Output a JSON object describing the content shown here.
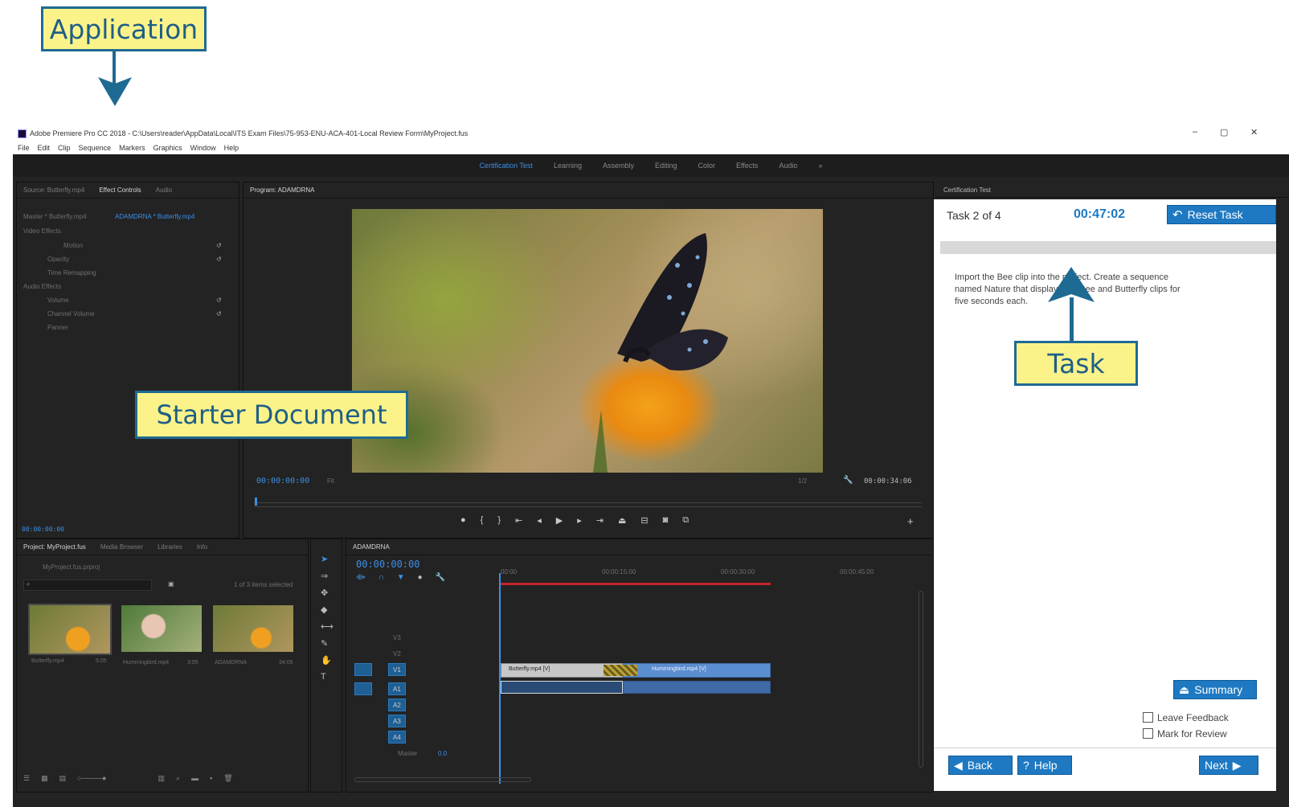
{
  "callouts": {
    "application": "Application",
    "starter_document": "Starter Document",
    "task": "Task"
  },
  "window": {
    "title": "Adobe Premiere Pro CC 2018 - C:\\Users\\reader\\AppData\\Local\\ITS Exam Files\\75-953-ENU-ACA-401-Local Review Form\\MyProject.fus",
    "menu": [
      "File",
      "Edit",
      "Clip",
      "Sequence",
      "Markers",
      "Graphics",
      "Window",
      "Help"
    ],
    "workspaces": [
      "Certification Test",
      "Learning",
      "Assembly",
      "Editing",
      "Color",
      "Effects",
      "Audio"
    ],
    "controls": [
      "–",
      "▢",
      "✕"
    ]
  },
  "effect_controls": {
    "tabs": [
      "Source: Butterfly.mp4",
      "Effect Controls",
      "Audio"
    ],
    "source_line": "Master * Butterfly.mp4",
    "sequence_line": "ADAMDRNA * Butterfly.mp4",
    "video_effects_header": "Video Effects",
    "effects": [
      "Motion",
      "Opacity",
      "Time Remapping"
    ],
    "audio_effects_header": "Audio Effects",
    "audio": [
      "Volume",
      "Channel Volume",
      "Panner"
    ],
    "timecode": "00:00:00:00"
  },
  "program": {
    "tab": "Program: ADAMDRNA",
    "timecode_left": "00:00:00:00",
    "fit": "Fit",
    "quality": "1/2",
    "timecode_right": "00:00:34:06"
  },
  "project": {
    "tabs": [
      "Project: MyProject.fus",
      "Media Browser",
      "Libraries",
      "Info"
    ],
    "path": "MyProject.fus.prproj",
    "selected": "1 of 3 items selected",
    "clips": [
      {
        "name": "Butterfly.mp4",
        "dur": "5:05"
      },
      {
        "name": "Hummingbird.mp4",
        "dur": "3:05"
      },
      {
        "name": "ADAMDRNA",
        "dur": "34:06"
      }
    ]
  },
  "timeline": {
    "tab": "ADAMDRNA",
    "timecode": "00:00:00:00",
    "ruler": [
      "00:00",
      "00:00:15:00",
      "00:00:30:00",
      "00:00:45:00"
    ],
    "tracks_video": [
      "V3",
      "V2",
      "V1"
    ],
    "tracks_audio": [
      "A1",
      "A2",
      "A3",
      "A4"
    ],
    "master": "Master",
    "master_val": "0.0",
    "clip1": "Butterfly.mp4 [V]",
    "clip2": "Hummingbird.mp4 [V]"
  },
  "cert": {
    "panel_tab": "Certification Test",
    "task_label": "Task 2 of 4",
    "timer": "00:47:02",
    "reset": "Reset Task",
    "instruction_1": "Import the Bee clip into the project. Create a sequence",
    "instruction_2": "named Nature that displays the Bee and Butterfly clips for",
    "instruction_3": "five seconds each.",
    "summary": "Summary",
    "leave_feedback": "Leave Feedback",
    "mark_review": "Mark for Review",
    "back": "Back",
    "help": "Help",
    "next": "Next"
  },
  "colors": {
    "accent_blue": "#1e79c2",
    "callout_yellow": "#fbf38a",
    "callout_border": "#1f6a93",
    "timecode_blue": "#3d8fe6"
  }
}
